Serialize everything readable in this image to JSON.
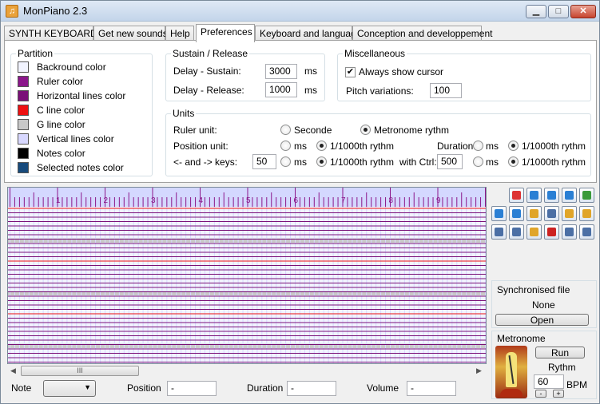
{
  "window": {
    "title": "MonPiano 2.3",
    "minimize": "▁",
    "maximize": "□",
    "close": "✕",
    "icon": "music-note-icon"
  },
  "tabs": [
    "SYNTH KEYBOARD",
    "Get new sounds",
    "Help",
    "Preferences",
    "Keyboard and language",
    "Conception and developpement"
  ],
  "partition": {
    "title": "Partition",
    "items": [
      {
        "label": "Backround color",
        "color": "#f2f4ff"
      },
      {
        "label": "Ruler color",
        "color": "#8b168b"
      },
      {
        "label": "Horizontal lines color",
        "color": "#7a1078"
      },
      {
        "label": "C line color",
        "color": "#ee1111"
      },
      {
        "label": "G line color",
        "color": "#c8c8c8"
      },
      {
        "label": "Vertical lines color",
        "color": "#d8d8ff"
      },
      {
        "label": "Notes color",
        "color": "#000000"
      },
      {
        "label": "Selected notes color",
        "color": "#174a7c"
      }
    ]
  },
  "sustain": {
    "title": "Sustain / Release",
    "delay_sustain_label": "Delay - Sustain:",
    "delay_sustain": "3000",
    "delay_release_label": "Delay - Release:",
    "delay_release": "1000",
    "unit": "ms"
  },
  "misc": {
    "title": "Miscellaneous",
    "always_show_cursor": "Always show cursor",
    "pitch_label": "Pitch variations:",
    "pitch": "100"
  },
  "units": {
    "title": "Units",
    "ruler_label": "Ruler unit:",
    "seconde": "Seconde",
    "metronome": "Metronome rythm",
    "position_label": "Position unit:",
    "ms": "ms",
    "rythm": "1/1000th rythm",
    "duration_label": "Duration:",
    "keys_label": "<- and -> keys:",
    "keys_value": "50",
    "ctrl_label": "with Ctrl:",
    "ctrl_value": "500"
  },
  "ruler": {
    "numbers": [
      "1",
      "2",
      "3",
      "4",
      "5",
      "6",
      "7",
      "8",
      "9"
    ]
  },
  "sync": {
    "title": "Synchronised file",
    "value": "None",
    "open": "Open"
  },
  "metronome": {
    "title": "Metronome",
    "run": "Run",
    "rythm_label": "Rythm",
    "rythm": "60",
    "bpm": "BPM",
    "minus": "-",
    "plus": "+"
  },
  "bottom": {
    "note_label": "Note",
    "position_label": "Position",
    "position": "-",
    "duration_label": "Duration",
    "duration": "-",
    "volume_label": "Volume",
    "volume": "-"
  },
  "scroll": {
    "thumb": "III",
    "left": "◀",
    "right": "▶"
  },
  "toolbar": [
    {
      "icon": "record-icon",
      "color": "#d33"
    },
    {
      "icon": "play-icon",
      "color": "#2a7fd4"
    },
    {
      "icon": "pause-icon",
      "color": "#2a7fd4"
    },
    {
      "icon": "stop-icon",
      "color": "#2a7fd4"
    },
    {
      "icon": "refresh-icon",
      "color": "#3a9a3a"
    },
    {
      "icon": "rewind-icon",
      "color": "#2a7fd4"
    },
    {
      "icon": "forward-icon",
      "color": "#2a7fd4"
    },
    {
      "icon": "open-folder-icon",
      "color": "#e0a52a"
    },
    {
      "icon": "save-icon",
      "color": "#4b6fa5"
    },
    {
      "icon": "zoom-in-icon",
      "color": "#e0a52a"
    },
    {
      "icon": "zoom-out-icon",
      "color": "#e0a52a"
    },
    {
      "icon": "select-icon",
      "color": "#4b6fa5"
    },
    {
      "icon": "cut-icon",
      "color": "#4b6fa5"
    },
    {
      "icon": "paste-icon",
      "color": "#e0a52a"
    },
    {
      "icon": "delete-icon",
      "color": "#cc2222"
    },
    {
      "icon": "undo-icon",
      "color": "#4b6fa5"
    },
    {
      "icon": "redo-icon",
      "color": "#4b6fa5"
    }
  ]
}
